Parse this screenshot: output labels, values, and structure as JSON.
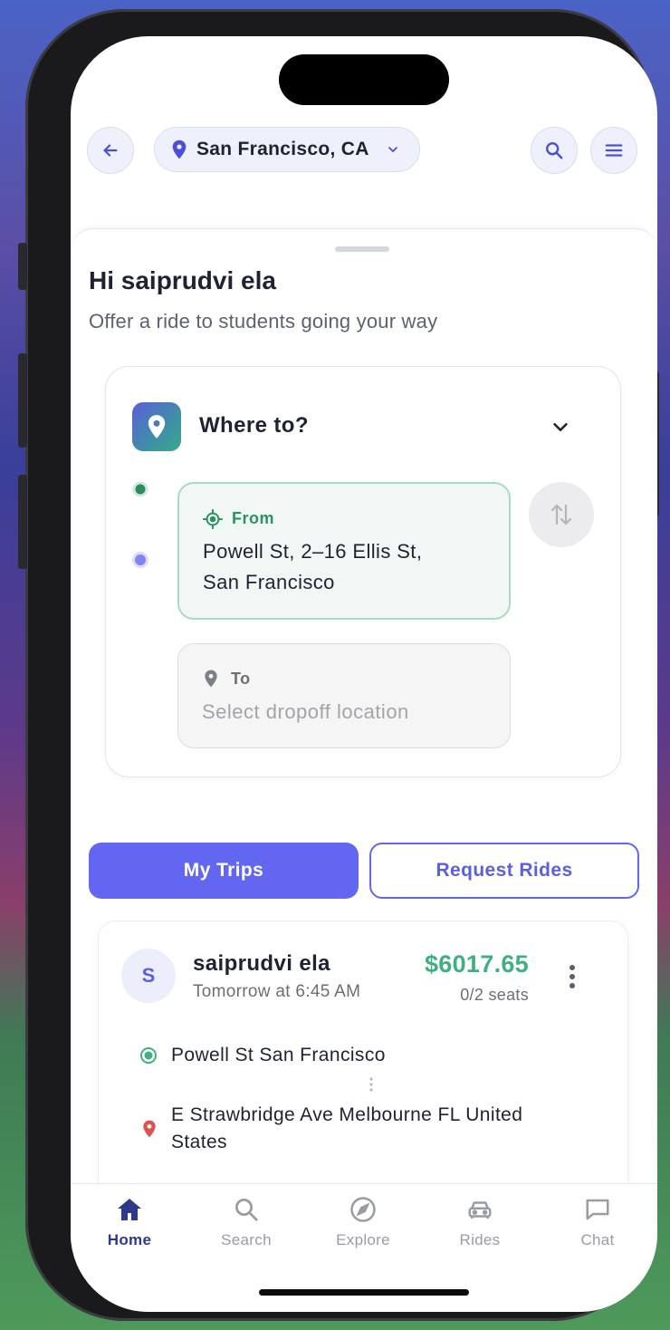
{
  "header": {
    "location": "San Francisco, CA"
  },
  "greeting": {
    "title": "Hi saiprudvi ela",
    "subtitle": "Offer a ride to students going your way"
  },
  "route_card": {
    "title": "Where to?",
    "from_label": "From",
    "from_line1": "Powell St, 2–16 Ellis St,",
    "from_line2": "San Francisco",
    "to_label": "To",
    "to_placeholder": "Select dropoff location"
  },
  "tabs": {
    "my_trips": "My Trips",
    "request_rides": "Request Rides"
  },
  "trip": {
    "avatar_initial": "S",
    "driver": "saiprudvi ela",
    "time": "Tomorrow at 6:45 AM",
    "price": "$6017.65",
    "seats": "0/2 seats",
    "origin": "Powell St San Francisco",
    "destination_line1": "E Strawbridge Ave Melbourne FL United",
    "destination_line2": "States"
  },
  "nav": [
    {
      "label": "Home",
      "icon": "home-icon",
      "active": true
    },
    {
      "label": "Search",
      "icon": "search-icon",
      "active": false
    },
    {
      "label": "Explore",
      "icon": "compass-icon",
      "active": false
    },
    {
      "label": "Rides",
      "icon": "car-icon",
      "active": false
    },
    {
      "label": "Chat",
      "icon": "chat-icon",
      "active": false
    }
  ],
  "colors": {
    "accent": "#6366f1",
    "green": "#3fb07f",
    "price_green": "#3fb07f",
    "nav_active": "#2d3a8a"
  }
}
